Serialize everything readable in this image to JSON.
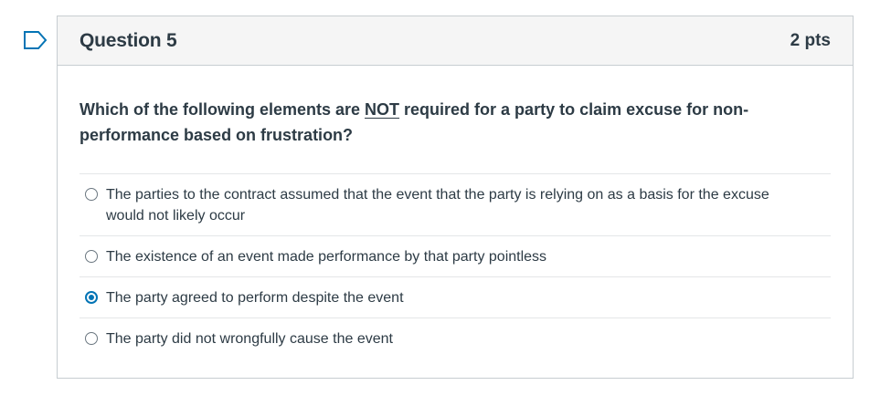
{
  "question": {
    "title": "Question 5",
    "points": "2 pts",
    "text_before": "Which of the following elements are ",
    "text_emphasis": "NOT",
    "text_after": " required for a party to claim excuse for non-performance based on frustration?"
  },
  "answers": [
    {
      "label": "The parties to the contract assumed that the event that the party is relying on as a basis for the excuse would not likely occur",
      "selected": false
    },
    {
      "label": "The existence of an event made performance by that party pointless",
      "selected": false
    },
    {
      "label": "The party agreed to perform despite the event",
      "selected": true
    },
    {
      "label": "The party did not wrongfully cause the event",
      "selected": false
    }
  ],
  "icons": {
    "flag": "flag-question-icon"
  },
  "colors": {
    "accent": "#0374b5",
    "text": "#2d3b45",
    "header_bg": "#f5f5f5",
    "border": "#c7cdd1"
  }
}
